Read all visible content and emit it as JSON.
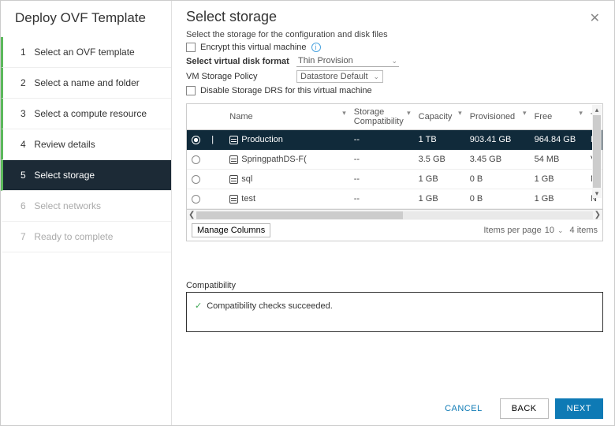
{
  "wizard": {
    "title": "Deploy OVF Template",
    "steps": [
      {
        "num": "1",
        "label": "Select an OVF template",
        "state": "done"
      },
      {
        "num": "2",
        "label": "Select a name and folder",
        "state": "done"
      },
      {
        "num": "3",
        "label": "Select a compute resource",
        "state": "done"
      },
      {
        "num": "4",
        "label": "Review details",
        "state": "done"
      },
      {
        "num": "5",
        "label": "Select storage",
        "state": "active"
      },
      {
        "num": "6",
        "label": "Select networks",
        "state": "future"
      },
      {
        "num": "7",
        "label": "Ready to complete",
        "state": "future"
      }
    ]
  },
  "page": {
    "heading": "Select storage",
    "subtext": "Select the storage for the configuration and disk files",
    "encrypt_label": "Encrypt this virtual machine",
    "disk_format_label": "Select virtual disk format",
    "disk_format_value": "Thin Provision",
    "policy_label": "VM Storage Policy",
    "policy_value": "Datastore Default",
    "disable_drs_label": "Disable Storage DRS for this virtual machine"
  },
  "table": {
    "columns": {
      "name": "Name",
      "compat": "Storage Compatibility",
      "capacity": "Capacity",
      "provisioned": "Provisioned",
      "free": "Free",
      "type": "T"
    },
    "rows": [
      {
        "selected": true,
        "name": "Production",
        "compat": "--",
        "capacity": "1 TB",
        "provisioned": "903.41 GB",
        "free": "964.84 GB",
        "type": "N"
      },
      {
        "selected": false,
        "name": "SpringpathDS-F(",
        "compat": "--",
        "capacity": "3.5 GB",
        "provisioned": "3.45 GB",
        "free": "54 MB",
        "type": "V"
      },
      {
        "selected": false,
        "name": "sql",
        "compat": "--",
        "capacity": "1 GB",
        "provisioned": "0 B",
        "free": "1 GB",
        "type": "N"
      },
      {
        "selected": false,
        "name": "test",
        "compat": "--",
        "capacity": "1 GB",
        "provisioned": "0 B",
        "free": "1 GB",
        "type": "N"
      }
    ],
    "manage_columns": "Manage Columns",
    "items_per_page_label": "Items per page",
    "items_per_page_value": "10",
    "count_label": "4 items"
  },
  "compat": {
    "label": "Compatibility",
    "message": "Compatibility checks succeeded."
  },
  "buttons": {
    "cancel": "CANCEL",
    "back": "BACK",
    "next": "NEXT"
  }
}
